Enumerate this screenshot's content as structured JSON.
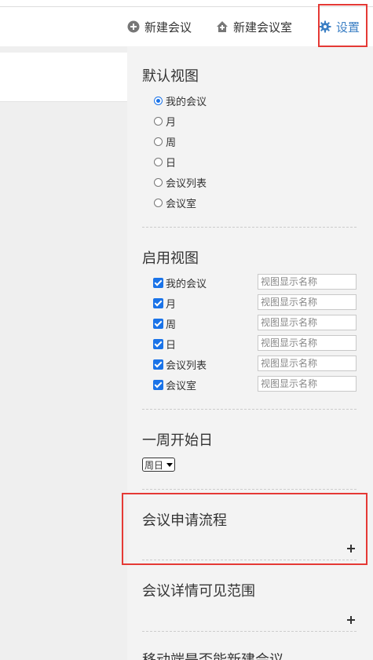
{
  "toolbar": {
    "new_meeting_label": "新建会议",
    "new_room_label": "新建会议室",
    "settings_label": "设置"
  },
  "settings": {
    "default_view": {
      "title": "默认视图",
      "options": [
        "我的会议",
        "月",
        "周",
        "日",
        "会议列表",
        "会议室"
      ],
      "selected": "我的会议"
    },
    "enabled_views": {
      "title": "启用视图",
      "items": [
        {
          "label": "我的会议",
          "checked": true
        },
        {
          "label": "月",
          "checked": true
        },
        {
          "label": "周",
          "checked": true
        },
        {
          "label": "日",
          "checked": true
        },
        {
          "label": "会议列表",
          "checked": true
        },
        {
          "label": "会议室",
          "checked": true
        }
      ],
      "input_placeholder": "视图显示名称"
    },
    "week_start": {
      "title": "一周开始日",
      "selected": "周日"
    },
    "approval_flow": {
      "title": "会议申请流程"
    },
    "detail_scope": {
      "title": "会议详情可见范围"
    },
    "mobile_create": {
      "title": "移动端是否能新建会议"
    }
  },
  "colors": {
    "accent": "#1a73e8",
    "settings_link": "#3b7fc4",
    "highlight": "#e53935",
    "panel_bg": "#f3f3f3"
  }
}
